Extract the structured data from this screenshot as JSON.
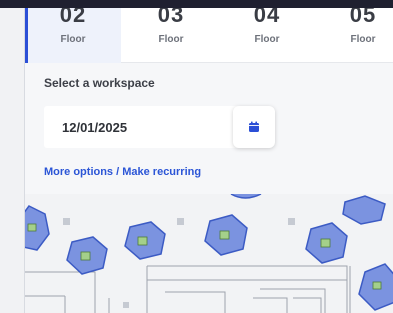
{
  "floor_tabs": [
    {
      "number": "02",
      "label": "Floor",
      "active": true
    },
    {
      "number": "03",
      "label": "Floor",
      "active": false
    },
    {
      "number": "04",
      "label": "Floor",
      "active": false
    },
    {
      "number": "05",
      "label": "Floor",
      "active": false
    }
  ],
  "workspace": {
    "section_label": "Select a workspace",
    "date_value": "12/01/2025",
    "calendar_icon": "calendar-icon",
    "more_options_link": "More options / Make recurring"
  },
  "colors": {
    "accent": "#2b4fd6",
    "link": "#2b55d6",
    "desk_fill": "#7b93e0",
    "desk_stroke": "#3c5bc4",
    "desk_center": "#a4d08a"
  },
  "map": {
    "icon": "floor-map",
    "desk_clusters": [
      "cluster-1",
      "cluster-2",
      "cluster-3",
      "cluster-4",
      "cluster-5",
      "cluster-6",
      "cluster-7",
      "cluster-8"
    ]
  }
}
